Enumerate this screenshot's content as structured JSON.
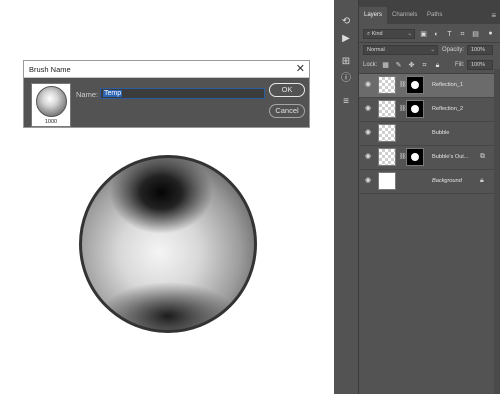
{
  "dialog": {
    "title": "Brush Name",
    "close_glyph": "✕",
    "brush_size": "1000",
    "name_label": "Name:",
    "name_value": "Temp",
    "ok_label": "OK",
    "cancel_label": "Cancel"
  },
  "panel": {
    "tabs": [
      {
        "label": "Layers",
        "active": true
      },
      {
        "label": "Channels",
        "active": false
      },
      {
        "label": "Paths",
        "active": false
      }
    ],
    "menu_icon": "hamburger-menu-icon",
    "filter": {
      "value": "Kind",
      "icon": "search-icon"
    },
    "blend_mode": "Normal",
    "opacity_label": "Opacity:",
    "opacity_value": "100%",
    "lock_label": "Lock:",
    "fill_label": "Fill:",
    "fill_value": "100%",
    "layers": [
      {
        "name": "Reflection_1",
        "italic": false,
        "selected": true,
        "thumb": "checker",
        "mask": true,
        "badge": ""
      },
      {
        "name": "Reflection_2",
        "italic": false,
        "selected": false,
        "thumb": "checker",
        "mask": true,
        "badge": ""
      },
      {
        "name": "Bubble",
        "italic": false,
        "selected": false,
        "thumb": "checker",
        "mask": false,
        "badge": ""
      },
      {
        "name": "Bubble's Out...",
        "italic": false,
        "selected": false,
        "thumb": "checker",
        "mask": true,
        "badge": "fx-icon"
      },
      {
        "name": "Background",
        "italic": true,
        "selected": false,
        "thumb": "white",
        "mask": false,
        "badge": "lock-icon"
      }
    ]
  },
  "toolstrip": {
    "icons": [
      "history-icon",
      "play-icon",
      "brush-settings-icon",
      "info-icon",
      "properties-icon"
    ]
  },
  "colors": {
    "panel_bg": "#535353",
    "tab_bar_bg": "#424242",
    "selected_layer": "#6b6b6b",
    "dialog_bg": "#535353"
  }
}
